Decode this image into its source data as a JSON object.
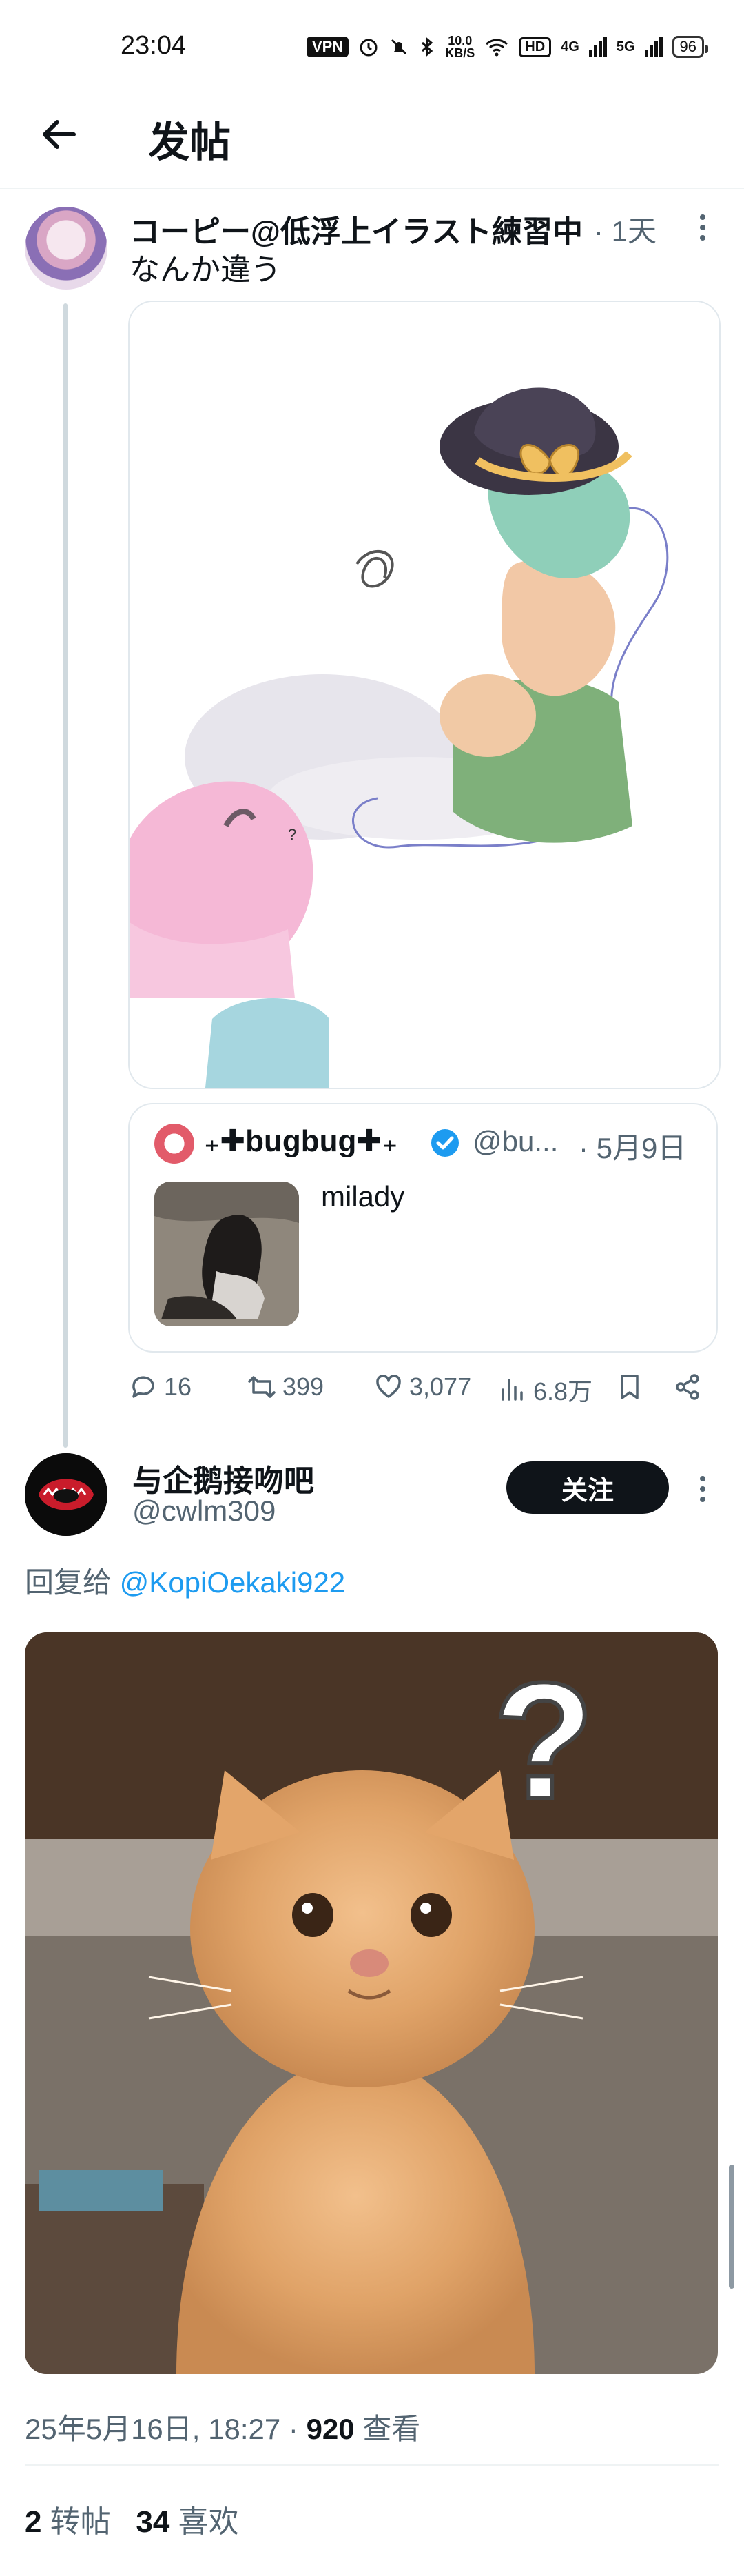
{
  "status_bar": {
    "time": "23:04",
    "vpn": "VPN",
    "speed_value": "10.0",
    "speed_unit": "KB/S",
    "hd": "HD",
    "net1": "4G",
    "net2": "5G",
    "battery": "96"
  },
  "header": {
    "title": "发帖"
  },
  "tweet": {
    "author_name": "コーピー@低浮上イラスト練習中",
    "time": "· 1天",
    "text": "なんか違う",
    "illustration_text": "?",
    "quote": {
      "name": "₊✚bugbug✚₊",
      "handle": "@bu...",
      "time": "· 5月9日",
      "text": "milady"
    },
    "actions": {
      "replies": "16",
      "retweets": "399",
      "likes": "3,077",
      "views": "6.8万"
    }
  },
  "reply": {
    "name": "与企鹅接吻吧",
    "handle": "@cwlm309",
    "follow_label": "关注",
    "reply_prefix": "回复给 ",
    "reply_mention": "@KopiOekaki922",
    "image_text": "?",
    "meta_date": "25年5月16日, 18:27 · ",
    "meta_views": "920",
    "meta_views_label": " 查看",
    "retweets_count": "2",
    "retweets_label": " 转帖",
    "likes_count": "34",
    "likes_label": " 喜欢"
  },
  "colors": {
    "link": "#1d9bf0",
    "muted": "#536471",
    "text": "#0f1419"
  }
}
